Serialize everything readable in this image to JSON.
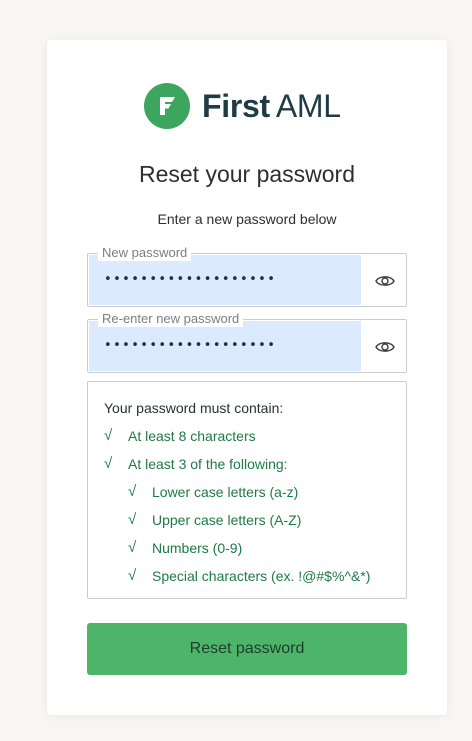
{
  "brand": {
    "word_bold": "First",
    "word_light": "AML",
    "logo_color": "#3ca65e",
    "text_color": "#1f3c44"
  },
  "page": {
    "title": "Reset your password",
    "subtitle": "Enter a new password below"
  },
  "new_password": {
    "label": "New password",
    "value": "•••••••••••••••••••",
    "eye_icon": "eye-icon"
  },
  "confirm_password": {
    "label": "Re-enter new password",
    "value": "•••••••••••••••••••",
    "eye_icon": "eye-icon"
  },
  "requirements": {
    "heading": "Your password must contain:",
    "check_symbol": "√",
    "items": [
      "At least 8 characters",
      "At least 3 of the following:",
      "Lower case letters (a-z)",
      "Upper case letters (A-Z)",
      "Numbers (0-9)",
      "Special characters (ex. !@#$%^&*)"
    ]
  },
  "submit": {
    "label": "Reset password",
    "color": "#4cb56a"
  }
}
